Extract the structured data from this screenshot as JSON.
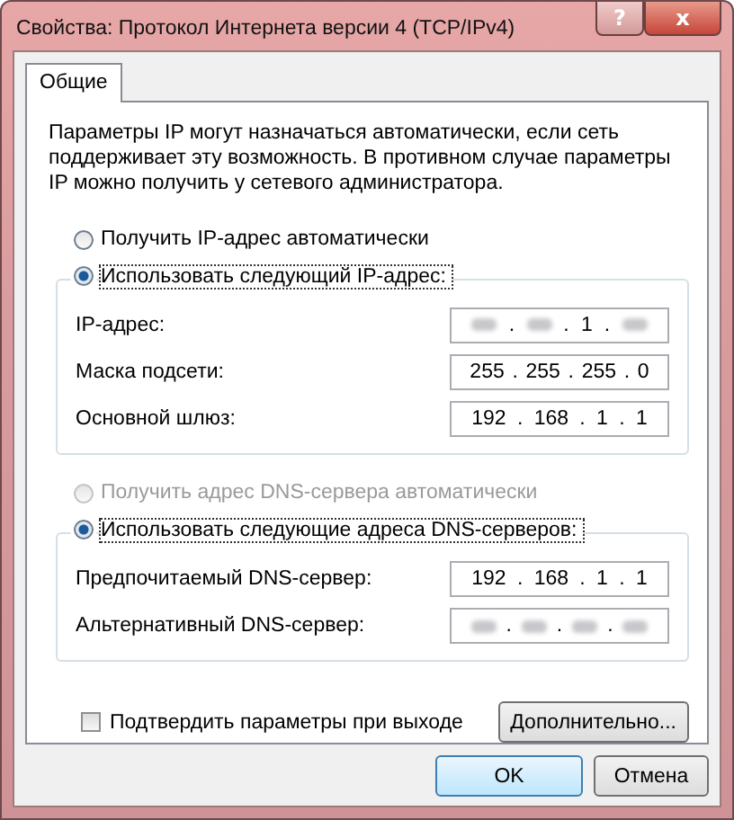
{
  "window": {
    "title": "Свойства: Протокол Интернета версии 4 (TCP/IPv4)",
    "help_button": "?",
    "close_button": "x"
  },
  "tabs": [
    {
      "label": "Общие",
      "selected": true
    }
  ],
  "description": "Параметры IP могут назначаться автоматически, если сеть поддерживает эту возможность. В противном случае параметры IP можно получить у сетевого администратора.",
  "ip_group": {
    "options": [
      {
        "label": "Получить IP-адрес автоматически",
        "selected": false,
        "disabled": false
      },
      {
        "label": "Использовать следующий IP-адрес:",
        "selected": true,
        "disabled": false
      }
    ],
    "fields": [
      {
        "label": "IP-адрес:",
        "octets": [
          {
            "blurred": true
          },
          {
            "separator": ".",
            "blurred": true
          },
          {
            "separator": ".",
            "text": "1"
          },
          {
            "separator": ".",
            "blurred": true
          }
        ]
      },
      {
        "label": "Маска подсети:",
        "octets": [
          {
            "text": "255"
          },
          {
            "separator": ".",
            "text": "255"
          },
          {
            "separator": ".",
            "text": "255"
          },
          {
            "separator": ".",
            "text": "0"
          }
        ]
      },
      {
        "label": "Основной шлюз:",
        "octets": [
          {
            "text": "192"
          },
          {
            "separator": ".",
            "text": "168"
          },
          {
            "separator": ".",
            "text": "1"
          },
          {
            "separator": ".",
            "text": "1"
          }
        ]
      }
    ]
  },
  "dns_group": {
    "options": [
      {
        "label": "Получить адрес DNS-сервера автоматически",
        "selected": false,
        "disabled": true
      },
      {
        "label": "Использовать следующие адреса DNS-серверов:",
        "selected": true,
        "disabled": false
      }
    ],
    "fields": [
      {
        "label": "Предпочитаемый DNS-сервер:",
        "octets": [
          {
            "text": "192"
          },
          {
            "separator": ".",
            "text": "168"
          },
          {
            "separator": ".",
            "text": "1"
          },
          {
            "separator": ".",
            "text": "1"
          }
        ]
      },
      {
        "label": "Альтернативный DNS-сервер:",
        "octets": [
          {
            "blurred": true
          },
          {
            "separator": ".",
            "blurred": true
          },
          {
            "separator": ".",
            "blurred": true
          },
          {
            "separator": ".",
            "blurred": true
          }
        ]
      }
    ]
  },
  "validate_on_exit": {
    "label": "Подтвердить параметры при выходе",
    "checked": false
  },
  "advanced_button": "Дополнительно...",
  "buttons": [
    {
      "label": "OK",
      "default": true
    },
    {
      "label": "Отмена",
      "default": false
    }
  ]
}
